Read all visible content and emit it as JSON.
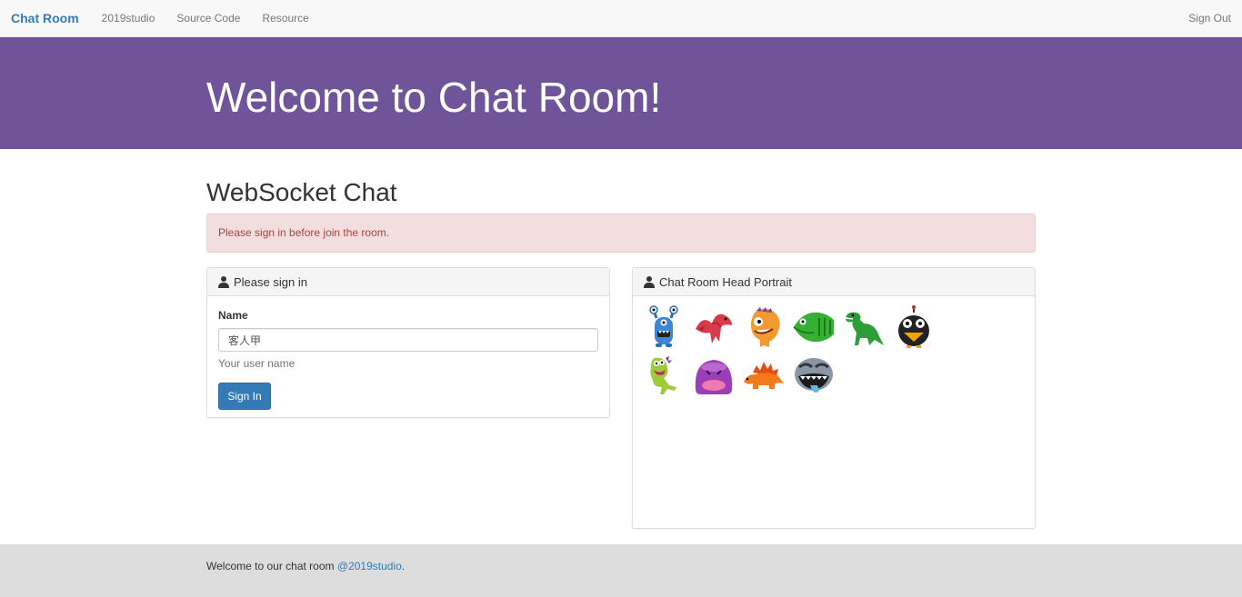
{
  "navbar": {
    "brand": "Chat Room",
    "links": [
      "2019studio",
      "Source Code",
      "Resource"
    ],
    "sign_out": "Sign Out"
  },
  "jumbotron": {
    "title": "Welcome to Chat Room!"
  },
  "main": {
    "heading": "WebSocket Chat",
    "alert": "Please sign in before join the room."
  },
  "sign_in_panel": {
    "title": "Please sign in",
    "name_label": "Name",
    "name_value": "客人甲",
    "help": "Your user name",
    "button": "Sign In"
  },
  "portrait_panel": {
    "title": "Chat Room Head Portrait",
    "avatars": [
      "blue-monster-icon",
      "red-dragon-icon",
      "orange-monster-icon",
      "green-fish-icon",
      "green-dinosaur-icon",
      "black-bird-icon",
      "green-lizard-icon",
      "purple-blob-icon",
      "orange-stegosaurus-icon",
      "gray-monster-icon"
    ]
  },
  "footer": {
    "text": "Welcome to our chat room",
    "link": "@2019studio",
    "suffix": "."
  },
  "colors": {
    "brand": "#337ab7",
    "jumbotron": "#6f5499",
    "alert_bg": "#f2dede",
    "alert_text": "#a94442",
    "footer_bg": "#dddddd"
  }
}
